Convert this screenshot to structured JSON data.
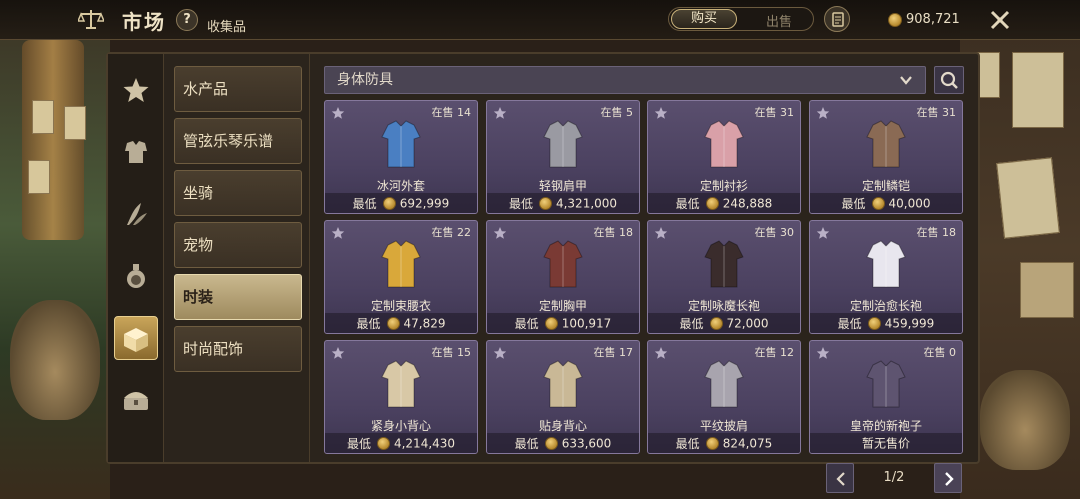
{
  "header": {
    "title": "市场",
    "help_label": "?",
    "subtitle": "收集品",
    "tabs": {
      "buy": "购买",
      "sell": "出售",
      "active": "buy"
    },
    "balance": "908,721"
  },
  "categories": [
    {
      "icon": "star-icon",
      "active": false
    },
    {
      "icon": "armor-icon",
      "active": false
    },
    {
      "icon": "herb-icon",
      "active": false
    },
    {
      "icon": "potion-icon",
      "active": false
    },
    {
      "icon": "chest-icon",
      "active": true
    },
    {
      "icon": "treasure-icon",
      "active": false
    }
  ],
  "subcategories": [
    {
      "label": "水产品",
      "active": false
    },
    {
      "label": "管弦乐琴乐谱",
      "active": false
    },
    {
      "label": "坐骑",
      "active": false
    },
    {
      "label": "宠物",
      "active": false
    },
    {
      "label": "时装",
      "active": true
    },
    {
      "label": "时尚配饰",
      "active": false
    }
  ],
  "filter": {
    "value": "身体防具"
  },
  "items": [
    {
      "name": "冰河外套",
      "stock": "在售 14",
      "price_label": "最低",
      "price": "692,999",
      "icon": "coat-icon",
      "color": "#4a7fc2"
    },
    {
      "name": "轻钢肩甲",
      "stock": "在售 5",
      "price_label": "最低",
      "price": "4,321,000",
      "icon": "shoulder-armor-icon",
      "color": "#9a9aa2"
    },
    {
      "name": "定制衬衫",
      "stock": "在售 31",
      "price_label": "最低",
      "price": "248,888",
      "icon": "shirt-icon",
      "color": "#d9a0a8"
    },
    {
      "name": "定制鳞铠",
      "stock": "在售 31",
      "price_label": "最低",
      "price": "40,000",
      "icon": "scale-armor-icon",
      "color": "#8a6a54"
    },
    {
      "name": "定制束腰衣",
      "stock": "在售 22",
      "price_label": "最低",
      "price": "47,829",
      "icon": "tunic-icon",
      "color": "#d9a83a"
    },
    {
      "name": "定制胸甲",
      "stock": "在售 18",
      "price_label": "最低",
      "price": "100,917",
      "icon": "breastplate-icon",
      "color": "#7a3a34"
    },
    {
      "name": "定制咏魔长袍",
      "stock": "在售 30",
      "price_label": "最低",
      "price": "72,000",
      "icon": "robe-icon",
      "color": "#3a2c2c"
    },
    {
      "name": "定制治愈长袍",
      "stock": "在售 18",
      "price_label": "最低",
      "price": "459,999",
      "icon": "white-robe-icon",
      "color": "#e8e6ee"
    },
    {
      "name": "紧身小背心",
      "stock": "在售 15",
      "price_label": "最低",
      "price": "4,214,430",
      "icon": "vest-icon",
      "color": "#d8c8a6"
    },
    {
      "name": "贴身背心",
      "stock": "在售 17",
      "price_label": "最低",
      "price": "633,600",
      "icon": "undershirt-icon",
      "color": "#c9b896"
    },
    {
      "name": "平纹披肩",
      "stock": "在售 12",
      "price_label": "最低",
      "price": "824,075",
      "icon": "shawl-icon",
      "color": "#a8a4ae"
    },
    {
      "name": "皇帝的新袍子",
      "stock": "在售 0",
      "price_label": "",
      "price": "暂无售价",
      "icon": "empty-armor-icon",
      "color": "#5e5470"
    }
  ],
  "pagination": {
    "text": "1/2"
  }
}
